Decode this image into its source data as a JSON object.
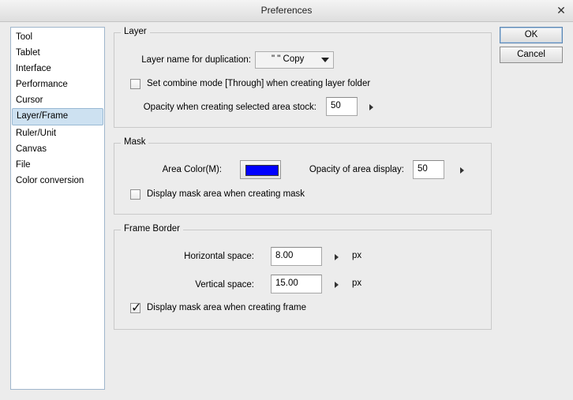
{
  "window": {
    "title": "Preferences",
    "close_glyph": "✕"
  },
  "sidebar": {
    "items": [
      {
        "label": "Tool"
      },
      {
        "label": "Tablet"
      },
      {
        "label": "Interface"
      },
      {
        "label": "Performance"
      },
      {
        "label": "Cursor"
      },
      {
        "label": "Layer/Frame",
        "selected": true
      },
      {
        "label": "Ruler/Unit"
      },
      {
        "label": "Canvas"
      },
      {
        "label": "File"
      },
      {
        "label": "Color conversion"
      }
    ]
  },
  "layer": {
    "title": "Layer",
    "dup_label": "Layer name for duplication:",
    "dup_value": "\"  \" Copy",
    "combine_label": "Set combine mode [Through] when creating layer folder",
    "combine_checked": false,
    "opacity_label": "Opacity when creating selected area stock:",
    "opacity_value": "50"
  },
  "mask": {
    "title": "Mask",
    "color_label": "Area Color(M):",
    "color": "#0000ff",
    "opacity_label": "Opacity of area display:",
    "opacity_value": "50",
    "display_label": "Display mask  area when creating mask",
    "display_checked": false
  },
  "frame": {
    "title": "Frame Border",
    "hspace_label": "Horizontal space:",
    "hspace_value": "8.00",
    "hspace_unit": "px",
    "vspace_label": "Vertical space:",
    "vspace_value": "15.00",
    "vspace_unit": "px",
    "display_label": "Display mask  area when creating frame",
    "display_checked": true
  },
  "buttons": {
    "ok": "OK",
    "cancel": "Cancel"
  }
}
